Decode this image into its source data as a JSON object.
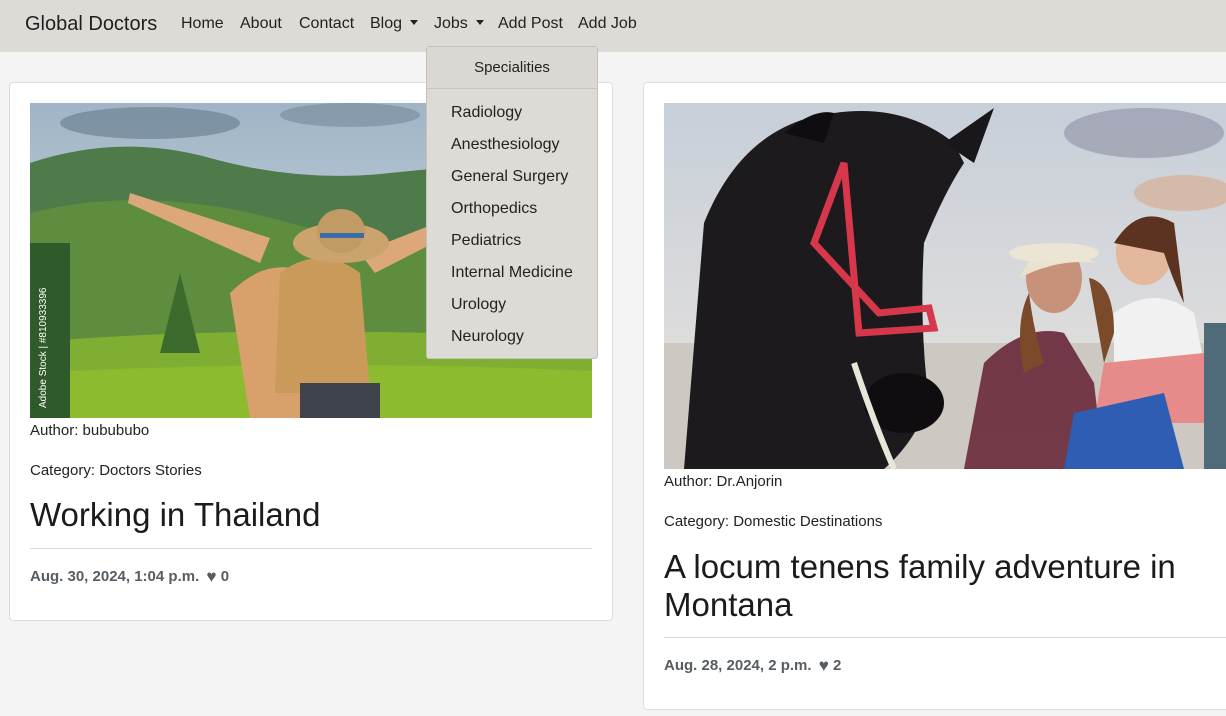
{
  "navbar": {
    "brand": "Global Doctors",
    "links": [
      "Home",
      "About",
      "Contact",
      "Blog",
      "Jobs",
      "Add Post",
      "Add Job"
    ]
  },
  "dropdown": {
    "header": "Specialities",
    "items": [
      "Radiology",
      "Anesthesiology",
      "General Surgery",
      "Orthopedics",
      "Pediatrics",
      "Internal Medicine",
      "Urology",
      "Neurology"
    ]
  },
  "posts": [
    {
      "author": "Author: bubububo",
      "category": "Category: Doctors Stories",
      "title": "Working in Thailand",
      "date": "Aug. 30, 2024, 1:04 p.m.",
      "likes": "0",
      "watermark": "Adobe Stock | #810933396"
    },
    {
      "author": "Author: Dr.Anjorin",
      "category": "Category: Domestic Destinations",
      "title": "A locum tenens family adventure in Montana",
      "date": "Aug. 28, 2024, 2 p.m.",
      "likes": "2"
    }
  ]
}
